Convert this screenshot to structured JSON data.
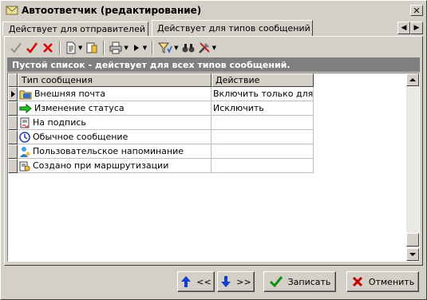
{
  "window": {
    "title": "Автоответчик (редактирование)",
    "close_label": "✕"
  },
  "tabs": [
    {
      "label": "Действует для отправителей",
      "icon": "user-icon",
      "active": false
    },
    {
      "label": "Действует для типов сообщений",
      "icon": "message-types-icon",
      "active": true
    }
  ],
  "infobar": {
    "text": "Пустой список - действует для всех типов сообщений."
  },
  "grid": {
    "columns": [
      "Тип сообщения",
      "Действие"
    ],
    "rows": [
      {
        "type": "Внешняя почта",
        "icon": "folder-mail-icon",
        "action": "Включить только для",
        "current": true
      },
      {
        "type": "Изменение статуса",
        "icon": "green-arrow-icon",
        "action": "Исключить",
        "current": false
      },
      {
        "type": "На подпись",
        "icon": "sign-document-icon",
        "action": "",
        "current": false
      },
      {
        "type": "Обычное сообщение",
        "icon": "clock-message-icon",
        "action": "",
        "current": false
      },
      {
        "type": "Пользовательское напоминание",
        "icon": "person-reminder-icon",
        "action": "",
        "current": false
      },
      {
        "type": "Создано при маршрутизации",
        "icon": "routing-icon",
        "action": "",
        "current": false
      }
    ]
  },
  "buttons": {
    "move_up": "<<",
    "move_down": ">>",
    "save": "Записать",
    "cancel": "Отменить"
  }
}
